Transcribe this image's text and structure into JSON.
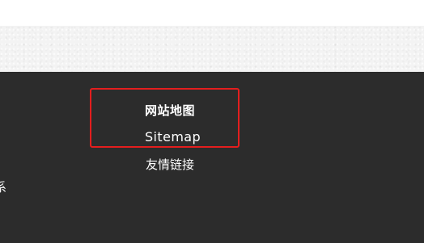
{
  "footer": {
    "heading": "网站地图",
    "sitemap_link": "Sitemap",
    "friend_links": "友情链接",
    "left_fragment": "系"
  },
  "colors": {
    "footer_bg": "#2c2c2c",
    "texture_bg": "#f3f3f3",
    "text": "#ffffff",
    "highlight": "#e41e1e"
  }
}
